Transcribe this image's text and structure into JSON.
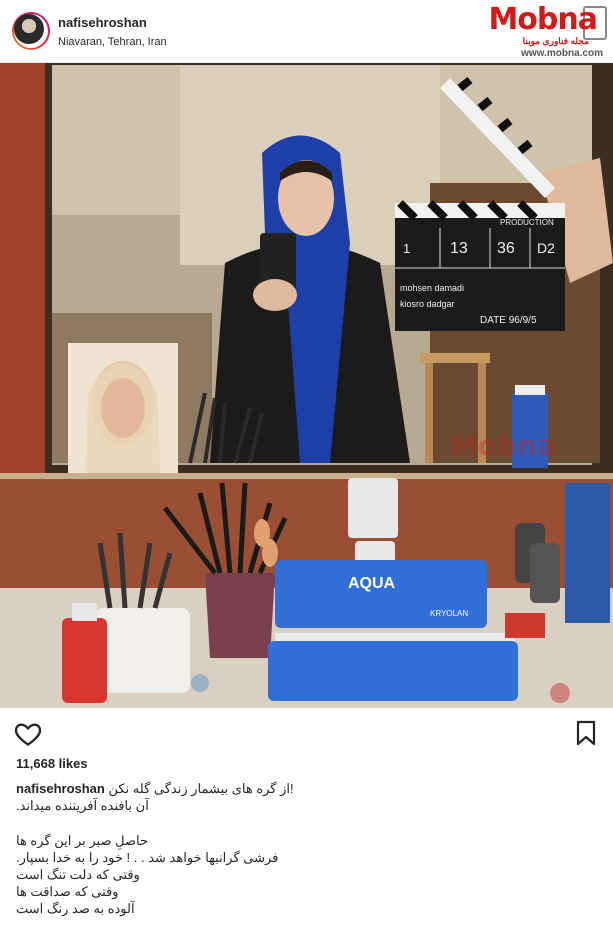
{
  "post": {
    "username": "nafisehroshan",
    "location": "Niavaran, Tehran, Iran",
    "likes": "11,668 likes"
  },
  "logo": {
    "name": "Mobna",
    "tagline": "مجله فناوری موبنا",
    "url": "www.mobna.com"
  },
  "photo": {
    "slate_production": "PRODUCTION",
    "slate_roll": "D2",
    "slate_scene": "36",
    "slate_take": "13",
    "slate_shot": "1",
    "slate_director": "mohsen damadi",
    "slate_camera": "kiosro dadgar",
    "slate_date": "DATE 96/9/5",
    "palette_brand": "AQUA",
    "palette_maker": "KRYOLAN",
    "watermark": "Mobna"
  },
  "caption": {
    "username": "nafisehroshan",
    "lines": [
      "از گره های بیشمار زندگی گله نکن!",
      "آن بافنده آفریننده میداند.",
      "",
      "حاصلِ صبر بر این گره ها",
      "فرشی گرانبها خواهد شد . . ! خود را به خدا بسپار.",
      "وقتی که دلت تنگ است",
      "وقتی که صداقت ها",
      "آلوده به صد رنگ است"
    ]
  },
  "colors": {
    "logo_red": "#d31a1a",
    "scarf_blue": "#1f3fa8",
    "palette_blue": "#2f6fd6"
  },
  "icons": [
    "heart-icon",
    "bookmark-icon",
    "camera-slate-icon"
  ]
}
